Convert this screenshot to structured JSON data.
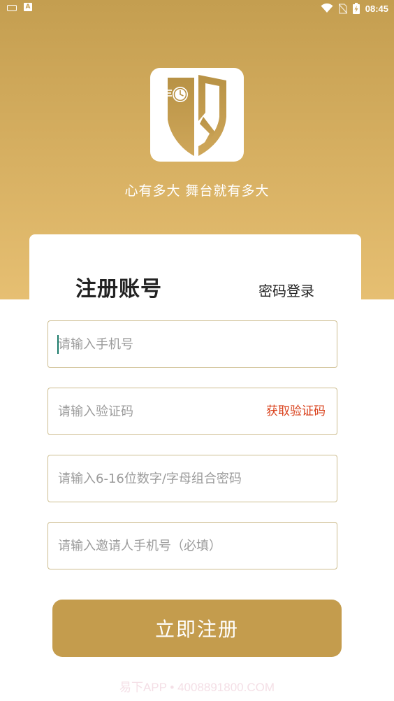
{
  "status_bar": {
    "time": "08:45",
    "left_icons": [
      "keyboard-icon",
      "a-notification-icon"
    ],
    "right_icons": [
      "wifi-icon",
      "no-sim-icon",
      "battery-charging-icon"
    ]
  },
  "logo": {
    "icon": "shield-k-clock-logo"
  },
  "slogan": "心有多大  舞台就有多大",
  "tabs": {
    "register": "注册账号",
    "password_login": "密码登录"
  },
  "form": {
    "phone_placeholder": "请输入手机号",
    "code_placeholder": "请输入验证码",
    "get_code_label": "获取验证码",
    "password_placeholder": "请输入6-16位数字/字母组合密码",
    "invite_placeholder": "请输入邀请人手机号（必填）"
  },
  "submit_label": "立即注册",
  "watermark": "易下APP • 4008891800.COM",
  "colors": {
    "brand_gold": "#c49c4d",
    "header_top": "#c49e50",
    "header_bottom": "#e6bf72",
    "get_code": "#d9401b",
    "field_border": "#cdbd8f",
    "cursor": "#1a7a6a"
  }
}
